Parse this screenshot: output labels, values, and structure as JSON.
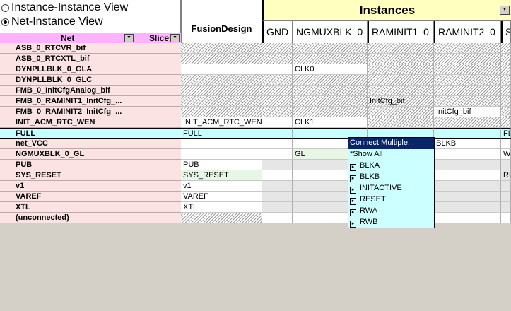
{
  "views": {
    "instance_instance": "Instance-Instance View",
    "net_instance": "Net-Instance View"
  },
  "columns": {
    "net": "Net",
    "slice": "Slice",
    "fusion": "FusionDesign",
    "instances": "Instances",
    "instance_cols": [
      "GND",
      "NGMUXBLK_0",
      "RAMINIT1_0",
      "RAMINIT2_0",
      "S"
    ]
  },
  "rows": [
    {
      "net": "ASB_0_RTCVR_bif",
      "fd": "",
      "c": [
        "",
        "",
        "",
        "",
        ""
      ]
    },
    {
      "net": "ASB_0_RTCXTL_bif",
      "fd": "",
      "c": [
        "",
        "",
        "",
        "",
        ""
      ]
    },
    {
      "net": "DYNPLLBLK_0_GLA",
      "fd": "",
      "c": [
        "",
        "CLK0",
        "",
        "",
        ""
      ]
    },
    {
      "net": "DYNPLLBLK_0_GLC",
      "fd": "",
      "c": [
        "",
        "",
        "",
        "",
        ""
      ]
    },
    {
      "net": "FMB_0_InitCfgAnalog_bif",
      "fd": "",
      "c": [
        "",
        "",
        "",
        "",
        ""
      ]
    },
    {
      "net": "FMB_0_RAMINIT1_InitCfg_...",
      "fd": "",
      "c": [
        "",
        "",
        "InitCfg_bif",
        "",
        ""
      ]
    },
    {
      "net": "FMB_0_RAMINIT2_InitCfg_...",
      "fd": "",
      "c": [
        "",
        "",
        "",
        "InitCfg_bif",
        ""
      ]
    },
    {
      "net": "INIT_ACM_RTC_WEN",
      "fd": "INIT_ACM_RTC_WEN",
      "c": [
        "",
        "CLK1",
        "",
        "",
        ""
      ]
    },
    {
      "net": "FULL",
      "fd": "FULL",
      "c": [
        "",
        "",
        "",
        "",
        "FL"
      ]
    },
    {
      "net": "net_VCC",
      "fd": "",
      "c": [
        "",
        "",
        "",
        "BLKB",
        ""
      ]
    },
    {
      "net": "NGMUXBLK_0_GL",
      "fd": "",
      "c": [
        "",
        "GL",
        "",
        "",
        "W"
      ]
    },
    {
      "net": "PUB",
      "fd": "PUB",
      "c": [
        "",
        "",
        "",
        "",
        ""
      ]
    },
    {
      "net": "SYS_RESET",
      "fd": "SYS_RESET",
      "c": [
        "",
        "",
        "",
        "",
        "RE"
      ]
    },
    {
      "net": "v1",
      "fd": "v1",
      "c": [
        "",
        "",
        "",
        "",
        ""
      ]
    },
    {
      "net": "VAREF",
      "fd": "VAREF",
      "c": [
        "",
        "",
        "",
        "",
        ""
      ]
    },
    {
      "net": "XTL",
      "fd": "XTL",
      "c": [
        "",
        "",
        "",
        "",
        ""
      ]
    },
    {
      "net": "(unconnected)",
      "fd": "",
      "c": [
        "",
        "",
        "",
        "",
        ""
      ]
    }
  ],
  "popup": {
    "connect_multiple": "Connect Multiple...",
    "show_all": "*Show All",
    "pins": [
      "BLKA",
      "BLKB",
      "INITACTIVE",
      "RESET",
      "RWA",
      "RWB"
    ]
  },
  "icons": {
    "dropdown": "chevron-down-icon",
    "pin": "pin-icon",
    "radio": "radio-icon"
  },
  "colors": {
    "net_header": "#ffb3ff",
    "net_row": "#fbe3e3",
    "instances_header": "#ffffc0",
    "selected_row": "#c8ffff",
    "popup_bg": "#ccffff",
    "popup_highlight": "#0a246a"
  }
}
